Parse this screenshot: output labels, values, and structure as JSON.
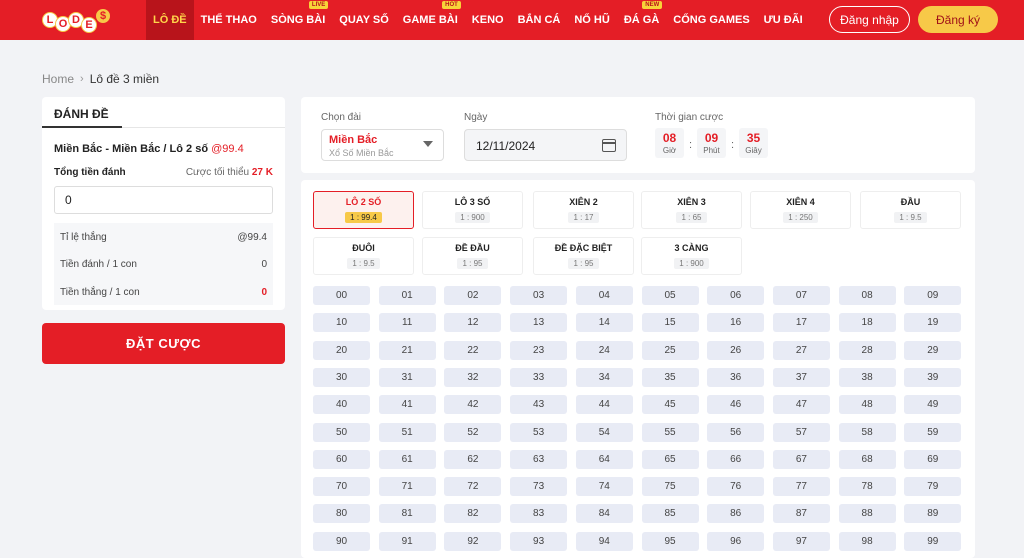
{
  "header": {
    "logo_letters": [
      "L",
      "O",
      "D",
      "E"
    ],
    "nav": [
      {
        "label": "LÔ ĐỀ",
        "badge": "",
        "active": true
      },
      {
        "label": "THỂ THAO",
        "badge": ""
      },
      {
        "label": "SÒNG BÀI",
        "badge": "LIVE"
      },
      {
        "label": "QUAY SỐ",
        "badge": ""
      },
      {
        "label": "GAME BÀI",
        "badge": "HOT"
      },
      {
        "label": "KENO",
        "badge": ""
      },
      {
        "label": "BẮN CÁ",
        "badge": ""
      },
      {
        "label": "NỔ HŨ",
        "badge": ""
      },
      {
        "label": "ĐÁ GÀ",
        "badge": "NEW"
      },
      {
        "label": "CỔNG GAMES",
        "badge": ""
      },
      {
        "label": "ƯU ĐÃI",
        "badge": ""
      }
    ],
    "login_label": "Đăng nhập",
    "register_label": "Đăng ký"
  },
  "breadcrumb": {
    "home": "Home",
    "current": "Lô đề 3 miền"
  },
  "bet_panel": {
    "tab_label": "ĐÁNH ĐỀ",
    "selection": "Miền Bắc - Miền Bắc / Lô 2 số",
    "selection_odds": "@99.4",
    "total_label": "Tổng tiền đánh",
    "min_bet_label": "Cược tối thiểu",
    "min_bet_value": "27 K",
    "amount_value": "0",
    "stats": [
      {
        "label": "Tỉ lệ thắng",
        "value": "@99.4"
      },
      {
        "label": "Tiền đánh / 1 con",
        "value": "0"
      },
      {
        "label": "Tiền thắng / 1 con",
        "value": "0"
      }
    ],
    "submit_label": "ĐẶT CƯỢC"
  },
  "filters": {
    "region_label": "Chọn đài",
    "region_value": "Miền Bắc",
    "region_sub": "Xổ Số Miền Bắc",
    "date_label": "Ngày",
    "date_value": "12/11/2024",
    "time_label": "Thời gian cược",
    "timer": [
      {
        "value": "08",
        "unit": "Giờ"
      },
      {
        "value": "09",
        "unit": "Phút"
      },
      {
        "value": "35",
        "unit": "Giây"
      }
    ],
    "timer_sep": ":"
  },
  "bet_types": [
    {
      "name": "LÔ 2 SỐ",
      "odds": "1 : 99.4",
      "active": true
    },
    {
      "name": "LÔ 3 SỐ",
      "odds": "1 : 900"
    },
    {
      "name": "XIÊN 2",
      "odds": "1 : 17"
    },
    {
      "name": "XIÊN 3",
      "odds": "1 : 65"
    },
    {
      "name": "XIÊN 4",
      "odds": "1 : 250"
    },
    {
      "name": "ĐẦU",
      "odds": "1 : 9.5"
    },
    {
      "name": "ĐUÔI",
      "odds": "1 : 9.5"
    },
    {
      "name": "ĐỀ ĐẦU",
      "odds": "1 : 95"
    },
    {
      "name": "ĐỀ ĐẶC BIỆT",
      "odds": "1 : 95"
    },
    {
      "name": "3 CÀNG",
      "odds": "1 : 900"
    }
  ],
  "numbers": [
    "00",
    "01",
    "02",
    "03",
    "04",
    "05",
    "06",
    "07",
    "08",
    "09",
    "10",
    "11",
    "12",
    "13",
    "14",
    "15",
    "16",
    "17",
    "18",
    "19",
    "20",
    "21",
    "22",
    "23",
    "24",
    "25",
    "26",
    "27",
    "28",
    "29",
    "30",
    "31",
    "32",
    "33",
    "34",
    "35",
    "36",
    "37",
    "38",
    "39",
    "40",
    "41",
    "42",
    "43",
    "44",
    "45",
    "46",
    "47",
    "48",
    "49",
    "50",
    "51",
    "52",
    "53",
    "54",
    "55",
    "56",
    "57",
    "58",
    "59",
    "60",
    "61",
    "62",
    "63",
    "64",
    "65",
    "66",
    "67",
    "68",
    "69",
    "70",
    "71",
    "72",
    "73",
    "74",
    "75",
    "76",
    "77",
    "78",
    "79",
    "80",
    "81",
    "82",
    "83",
    "84",
    "85",
    "86",
    "87",
    "88",
    "89",
    "90",
    "91",
    "92",
    "93",
    "94",
    "95",
    "96",
    "97",
    "98",
    "99"
  ]
}
